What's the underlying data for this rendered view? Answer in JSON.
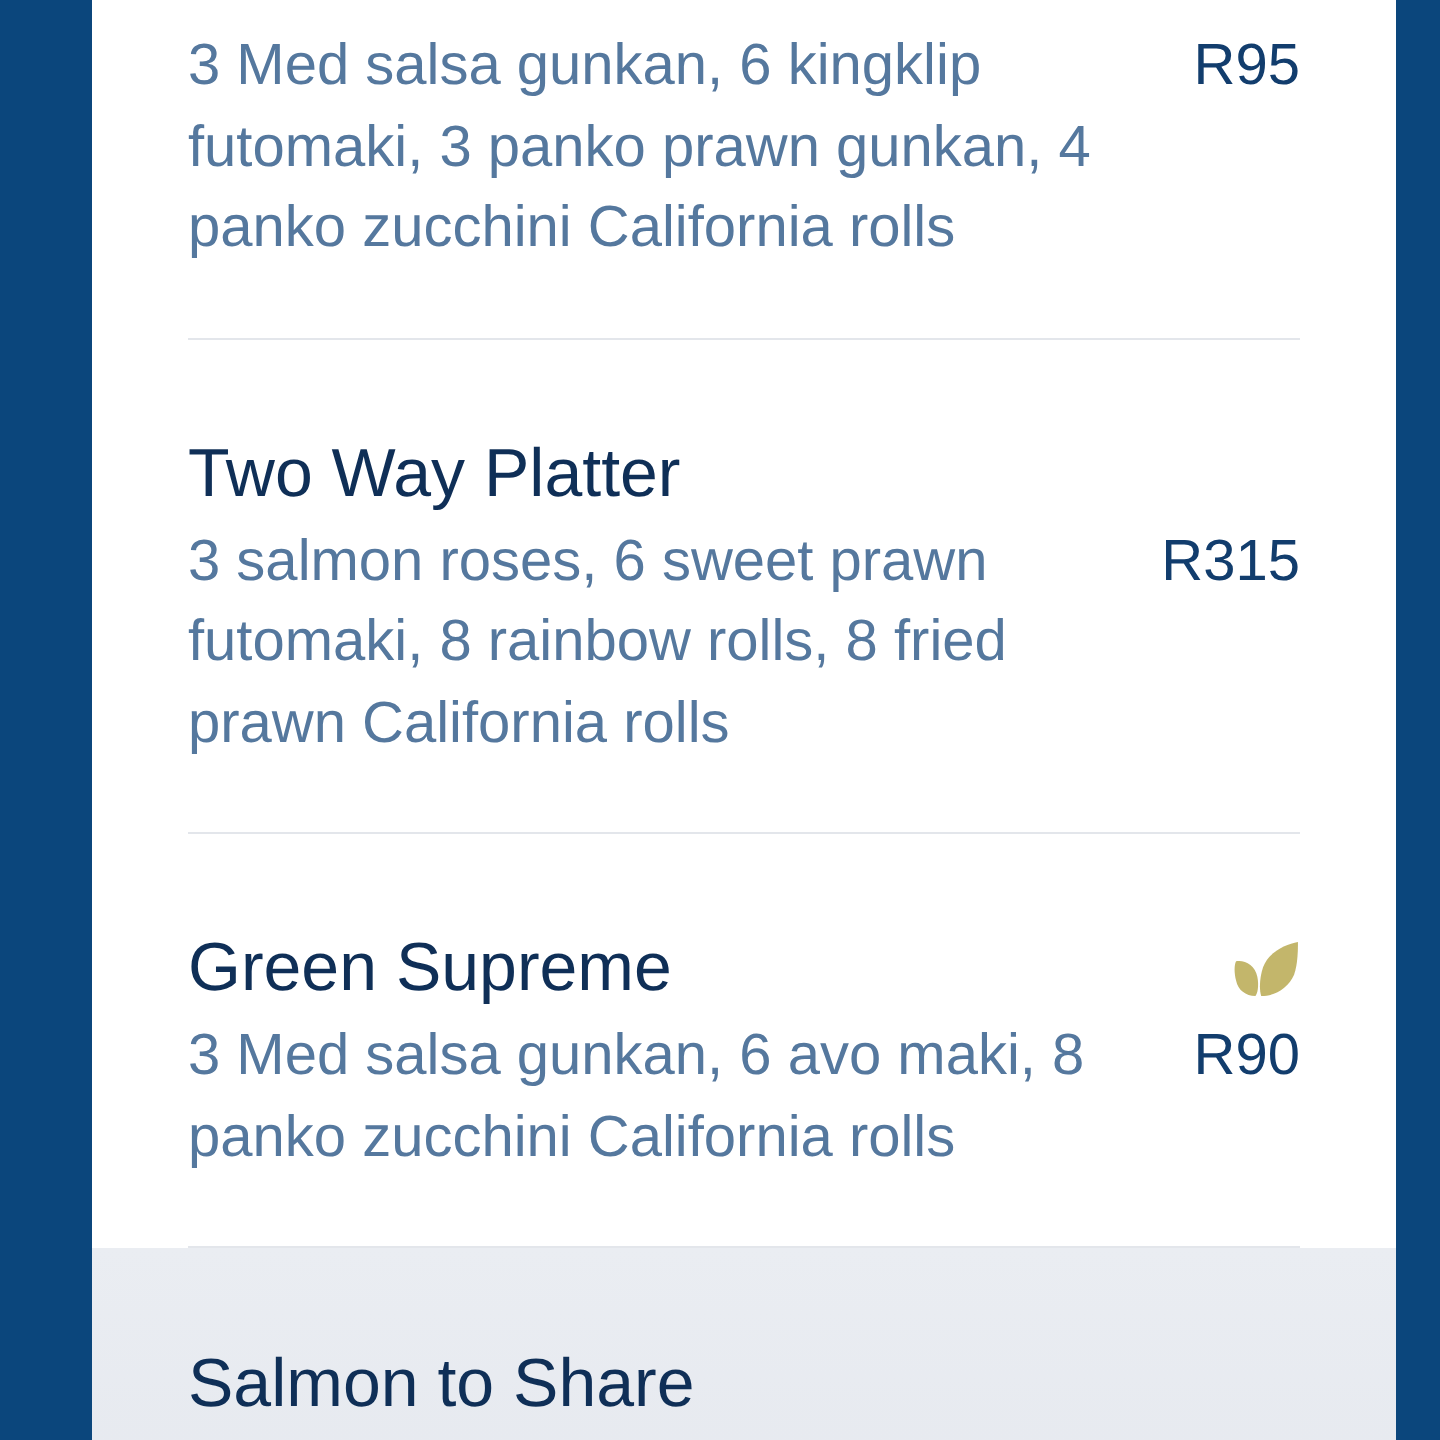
{
  "items": [
    {
      "description": "3 Med salsa gunkan, 6 kingklip futomaki, 3 panko prawn gunkan, 4 panko zucchini California rolls",
      "price": "R95",
      "vegetarian": false
    },
    {
      "title": "Two Way Platter",
      "description": "3 salmon roses, 6 sweet prawn futomaki, 8 rainbow rolls, 8 fried prawn California rolls",
      "price": "R315",
      "vegetarian": false
    },
    {
      "title": "Green Supreme",
      "description": "3 Med salsa gunkan, 6 avo maki, 8 panko zucchini California rolls",
      "price": "R90",
      "vegetarian": true
    }
  ],
  "next_section": {
    "title": "Salmon to Share"
  }
}
